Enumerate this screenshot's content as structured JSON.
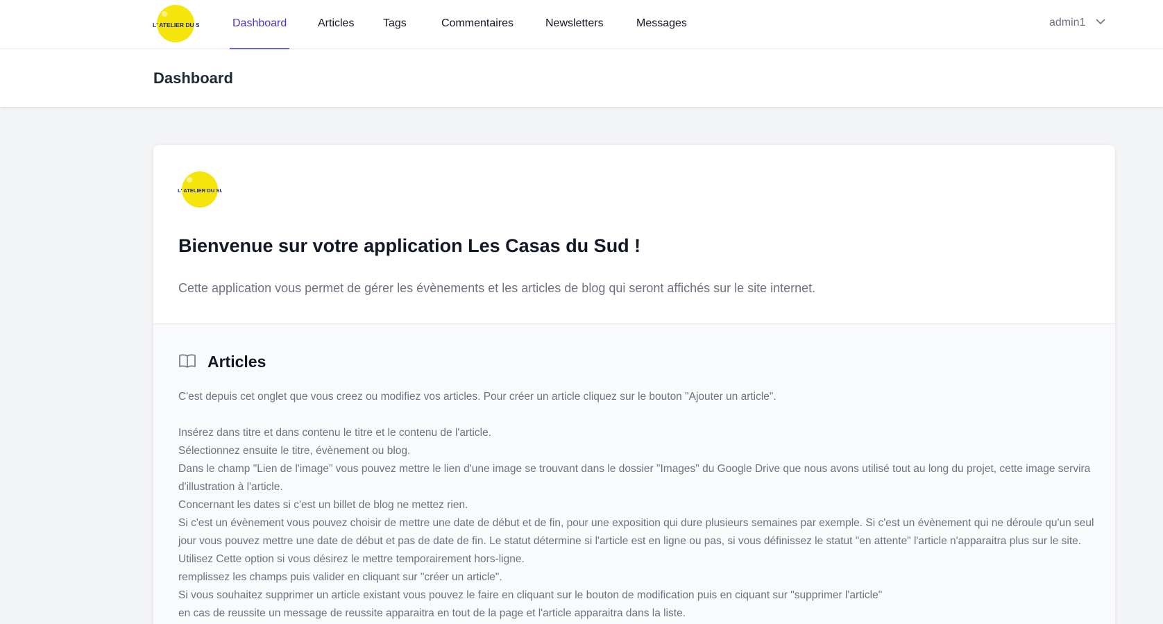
{
  "brand": {
    "logo_text": "L' ATELIER DU SUD",
    "logo_color": "#f5e50a",
    "logo_text_color": "#1e2a78"
  },
  "nav": {
    "items": [
      {
        "label": "Dashboard",
        "active": true
      },
      {
        "label": "Articles",
        "active": false
      },
      {
        "label": "Tags",
        "active": false
      },
      {
        "label": "Commentaires",
        "active": false
      },
      {
        "label": "Newsletters",
        "active": false
      },
      {
        "label": "Messages",
        "active": false
      }
    ],
    "accent_color": "#4338ca"
  },
  "user": {
    "name": "admin1",
    "icon": "chevron-down-icon"
  },
  "header": {
    "title": "Dashboard"
  },
  "welcome": {
    "title": "Bienvenue sur votre application Les Casas du Sud !",
    "description": "Cette application vous permet de gérer les évènements et les articles de blog qui seront affichés sur le site internet."
  },
  "articles_section": {
    "icon": "book-open-icon",
    "title": "Articles",
    "intro": "C'est depuis cet onglet que vous creez ou modifiez vos articles. Pour créer un article cliquez sur le bouton \"Ajouter un article\".",
    "lines": [
      "Insérez dans titre et dans contenu le titre et le contenu de l'article.",
      "Sélectionnez ensuite le titre, évènement ou blog.",
      "Dans le champ \"Lien de l'image\" vous pouvez mettre le lien d'une image se trouvant dans le dossier \"Images\" du Google Drive que nous avons utilisé tout au long du projet, cette image servira d'illustration à l'article.",
      "Concernant les dates si c'est un billet de blog ne mettez rien.",
      "Si c'est un évènement vous pouvez choisir de mettre une date de début et de fin, pour une exposition qui dure plusieurs semaines par exemple. Si c'est un évènement qui ne déroule qu'un seul jour vous pouvez mettre une date de début et pas de date de fin. Le statut détermine si l'article est en ligne ou pas, si vous définissez le statut \"en attente\" l'article n'apparaitra plus sur le site. Utilisez Cette option si vous désirez le mettre temporairement hors-ligne.",
      "remplissez les champs puis valider en cliquant sur \"créer un article\".",
      "Si vous souhaitez supprimer un article existant vous pouvez le faire en cliquant sur le bouton de modification puis en ciquant sur \"supprimer l'article\"",
      "en cas de reussite un message de reussite apparaitra en tout de la page et l'article apparaitra dans la liste."
    ]
  }
}
